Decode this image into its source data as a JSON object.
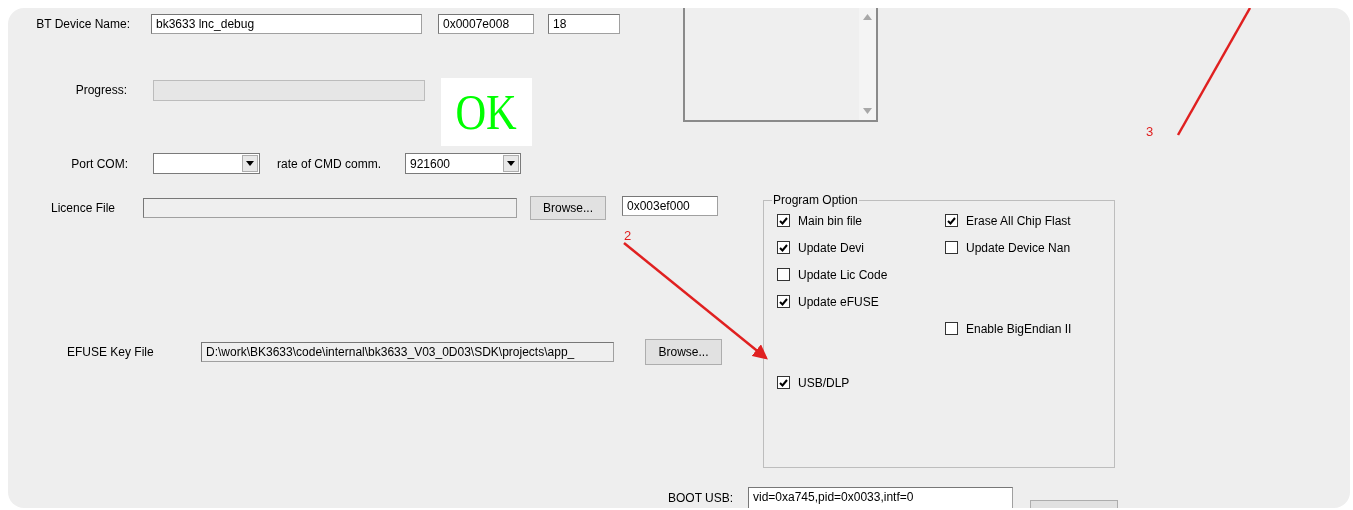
{
  "device_name": {
    "label": "BT Device Name:",
    "value": "bk3633 lnc_debug",
    "address": "0x0007e008",
    "length": "18"
  },
  "progress": {
    "label": "Progress:",
    "level": 0,
    "result": "OK"
  },
  "port": {
    "label": "Port COM:",
    "rate_label": "rate of CMD comm.",
    "rate_value": "921600"
  },
  "licence": {
    "label": "Licence File",
    "disabled": true,
    "browse": "Browse...",
    "address": "0x003ef000"
  },
  "efuse": {
    "label": "EFUSE Key File",
    "value": "D:\\work\\BK3633\\code\\internal\\bk3633_V03_0D03\\SDK\\projects\\app_",
    "disabled": true,
    "browse": "Browse..."
  },
  "program_option": {
    "title": "Program Option",
    "left": [
      {
        "label": "Main bin file",
        "checked": true
      },
      {
        "label": "Update Devi",
        "checked": true
      },
      {
        "label": "Update Lic Code",
        "checked": false
      },
      {
        "label": "Update eFUSE",
        "checked": true
      },
      {
        "label": "USB/DLP",
        "checked": true
      }
    ],
    "right": [
      {
        "label": "Erase All Chip Flast",
        "checked": true
      },
      {
        "label": "Update Device Nan",
        "checked": false
      },
      {
        "label": "Enable BigEndian II",
        "checked": false
      }
    ]
  },
  "boot_usb": {
    "label": "BOOT USB:",
    "value": "vid=0xa745,pid=0x0033,intf=0"
  },
  "annotations": [
    {
      "label": "2",
      "kind": "arrow"
    },
    {
      "label": "3",
      "kind": "line"
    }
  ]
}
